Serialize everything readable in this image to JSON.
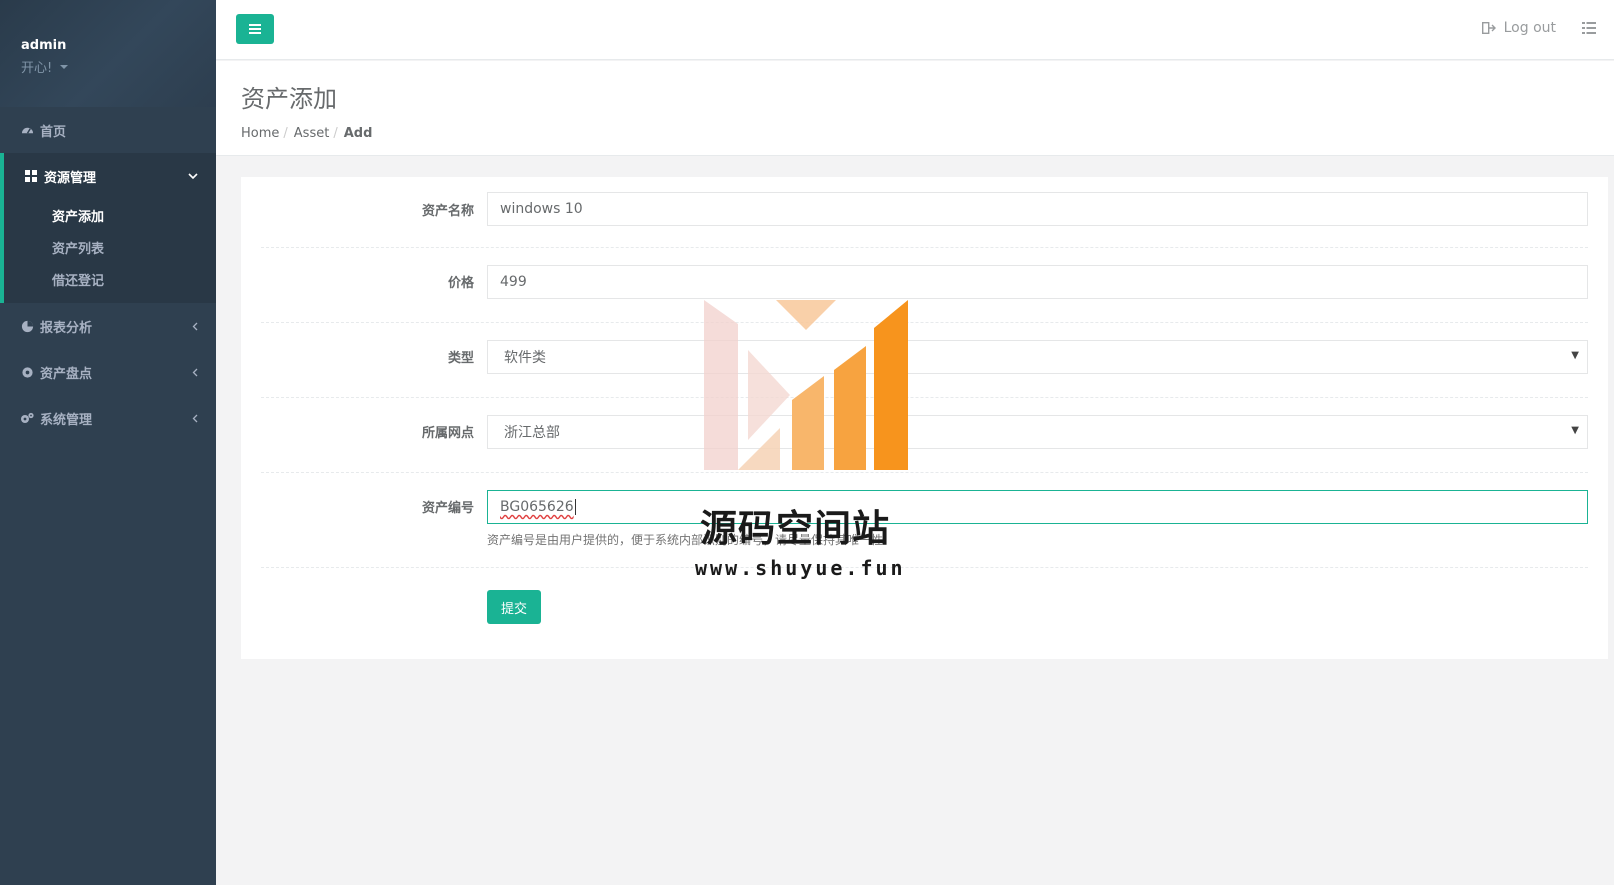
{
  "user": {
    "name": "admin",
    "role": "开心!"
  },
  "nav": {
    "home": "首页",
    "resource": {
      "label": "资源管理",
      "children": [
        "资产添加",
        "资产列表",
        "借还登记"
      ]
    },
    "reports": "报表分析",
    "inventory": "资产盘点",
    "system": "系统管理"
  },
  "topbar": {
    "logout": "Log out"
  },
  "heading": {
    "title": "资产添加",
    "breadcrumb": [
      "Home",
      "Asset",
      "Add"
    ]
  },
  "form": {
    "name": {
      "label": "资产名称",
      "value": "windows 10"
    },
    "price": {
      "label": "价格",
      "value": "499"
    },
    "type": {
      "label": "类型",
      "value": "软件类"
    },
    "branch": {
      "label": "所属网点",
      "value": "浙江总部"
    },
    "code": {
      "label": "资产编号",
      "value": "BG065626",
      "help": "资产编号是由用户提供的，便于系统内部识别的编号，请尽量保持其唯一性."
    },
    "submit": "提交"
  },
  "watermark": {
    "title": "源码空间站",
    "url": "www.shuyue.fun"
  },
  "colors": {
    "sidebar": "#2f4050",
    "accent": "#1ab394",
    "watermark_orange": "#f7941d"
  }
}
